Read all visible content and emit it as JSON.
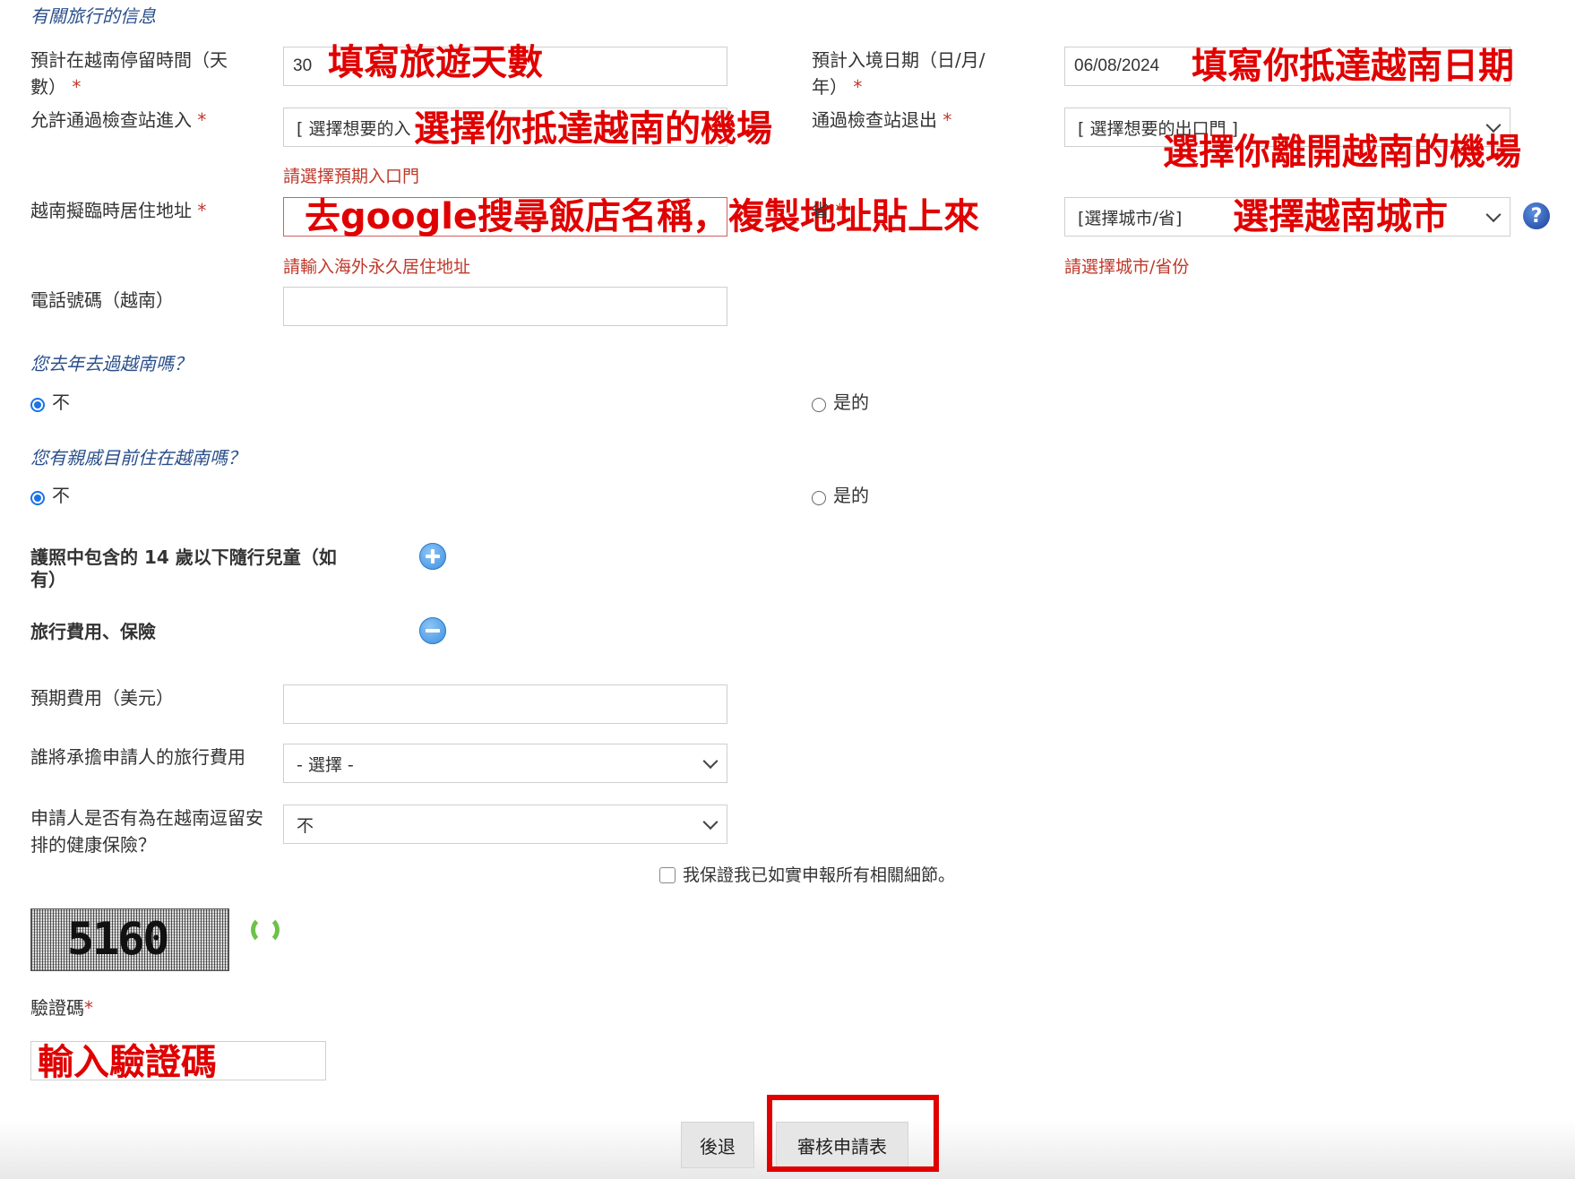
{
  "section_travel": "有關旅行的信息",
  "stay_days": {
    "label": "預計在越南停留時間（天數）",
    "value": "30",
    "annotation": "填寫旅遊天數"
  },
  "entry_date": {
    "label": "預計入境日期（日/月/年）",
    "value": "06/08/2024",
    "annotation": "填寫你抵達越南日期"
  },
  "entry_gate": {
    "label": "允許通過檢查站進入",
    "value": "[ 選擇想要的入",
    "error": "請選擇預期入口門",
    "annotation": "選擇你抵達越南的機場"
  },
  "exit_gate": {
    "label": "通過檢查站退出",
    "value": "[ 選擇想要的出口門 ]",
    "annotation": "選擇你離開越南的機場"
  },
  "temp_address": {
    "label": "越南擬臨時居住地址",
    "error": "請輸入海外永久居住地址",
    "annotation": "去google搜尋飯店名稱，複製地址貼上來"
  },
  "province": {
    "label": "省",
    "value": "[選擇城市/省]",
    "error": "請選擇城市/省份",
    "annotation": "選擇越南城市"
  },
  "phone": {
    "label": "電話號碼（越南）",
    "value": ""
  },
  "visited_last_year": {
    "question": "您去年去過越南嗎？",
    "no": "不",
    "yes": "是的"
  },
  "relatives": {
    "question": "您有親戚目前住在越南嗎？",
    "no": "不",
    "yes": "是的"
  },
  "children": {
    "label": "護照中包含的 14 歲以下隨行兒童（如有）"
  },
  "expenses_section": {
    "label": "旅行費用、保險"
  },
  "expected_cost": {
    "label": "預期費用（美元）",
    "value": ""
  },
  "payer": {
    "label": "誰將承擔申請人的旅行費用",
    "value": "- 選擇 -"
  },
  "insurance": {
    "label": "申請人是否有為在越南逗留安排的健康保險？",
    "value": "不"
  },
  "declaration": "我保證我已如實申報所有相關細節。",
  "captcha": {
    "label": "驗證碼",
    "image_text": "5160",
    "annotation": "輸入驗證碼"
  },
  "buttons": {
    "back": "後退",
    "review": "審核申請表"
  },
  "colors": {
    "annotation": "#e00000",
    "error": "#c0392b",
    "accent": "#1a73e8"
  }
}
